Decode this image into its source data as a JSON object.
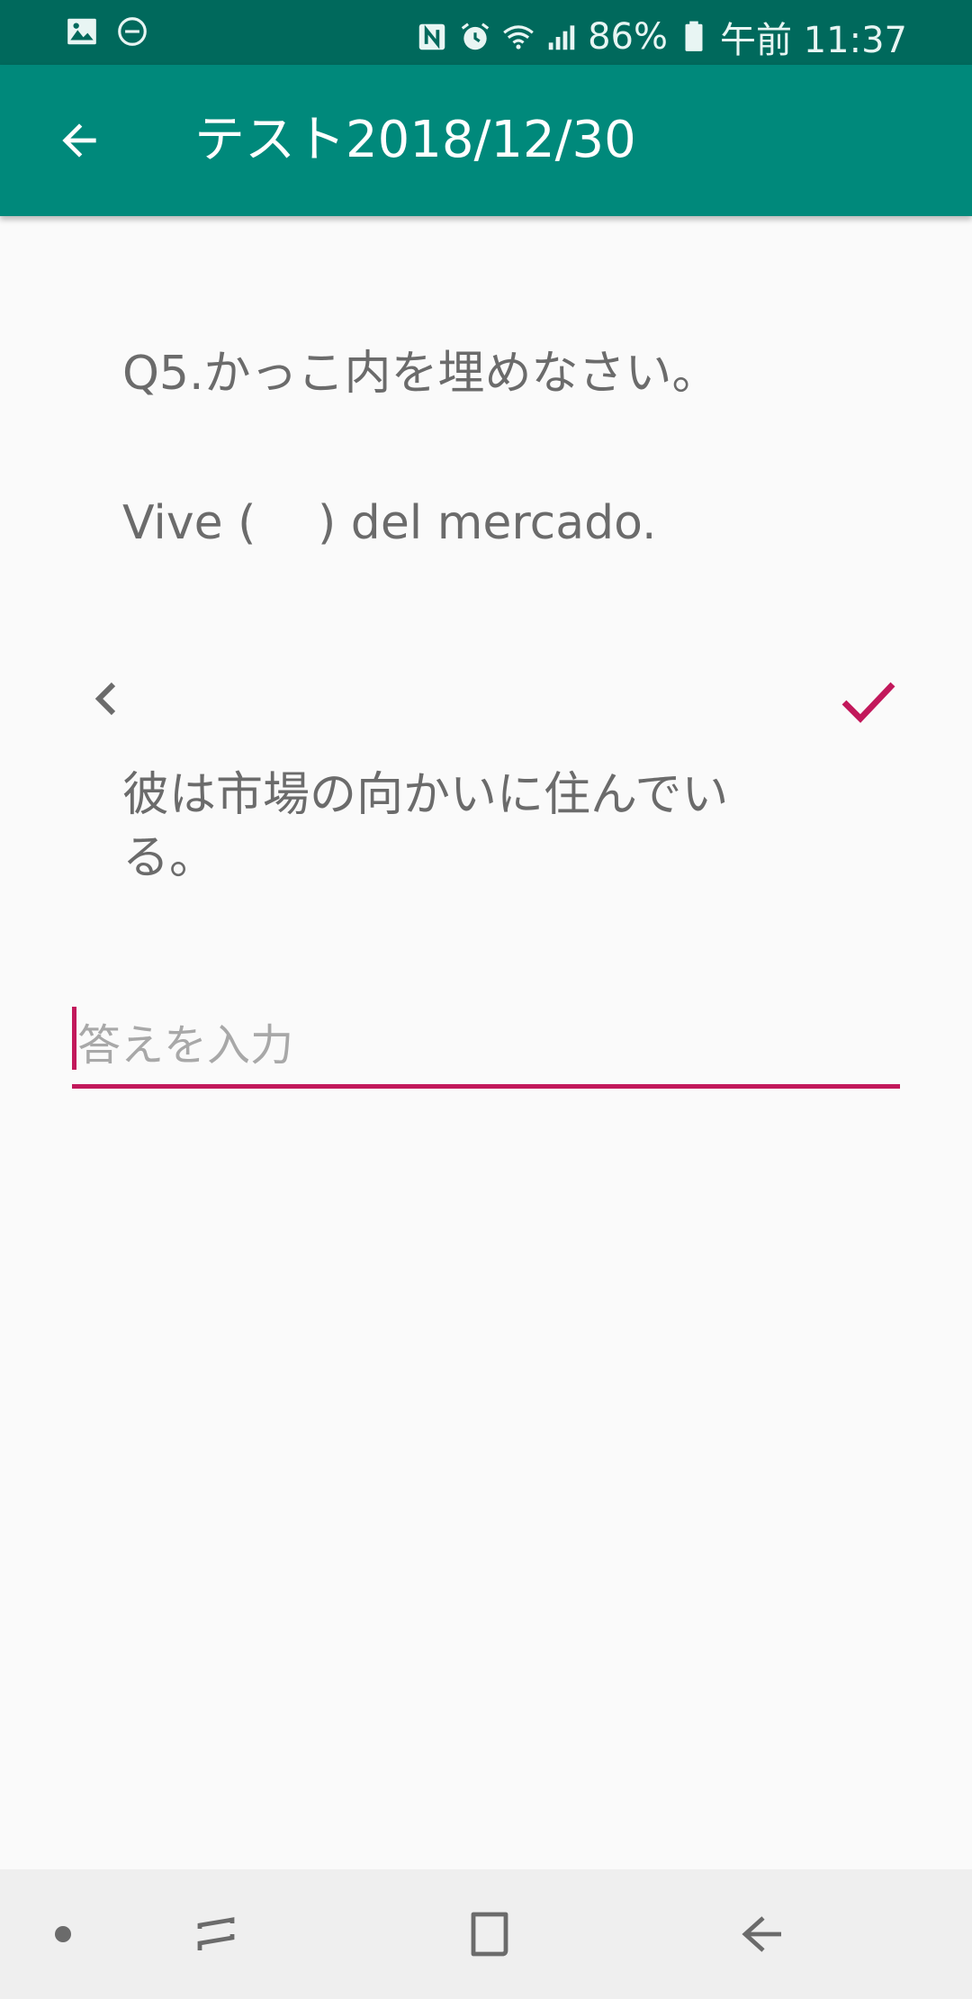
{
  "status_bar": {
    "battery": "86%",
    "time": "午前 11:37",
    "icons": [
      "image-icon",
      "do-not-disturb-icon",
      "nfc-icon",
      "alarm-icon",
      "wifi-icon",
      "signal-icon",
      "battery-icon"
    ]
  },
  "app_bar": {
    "title": "テスト2018/12/30",
    "back_icon": "arrow-back-icon"
  },
  "question": {
    "label": "Q5.かっこ内を埋めなさい。",
    "sentence": "Vive (　 ) del mercado.",
    "hint": "彼は市場の向かいに住んでいる。"
  },
  "controls": {
    "prev_icon": "chevron-left-icon",
    "check_icon": "check-icon"
  },
  "answer": {
    "placeholder": "答えを入力",
    "value": ""
  },
  "colors": {
    "status_bar": "#00695c",
    "app_bar": "#00897b",
    "accent": "#c2185b",
    "text": "#6b6b6b",
    "background": "#fafafa"
  },
  "nav_bar": {
    "icons": [
      "dot-icon",
      "recent-apps-icon",
      "home-icon",
      "back-icon"
    ]
  }
}
